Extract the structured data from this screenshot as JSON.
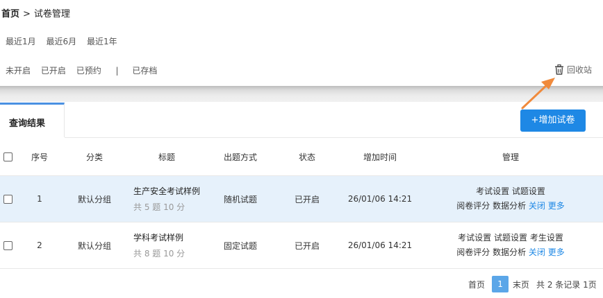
{
  "breadcrumb": {
    "home": "首页",
    "separator": ">",
    "current": "试卷管理"
  },
  "time_filters": [
    "最近1月",
    "最近6月",
    "最近1年"
  ],
  "status_filters": {
    "open_pending": "未开启",
    "opened": "已开启",
    "reserved": "已预约",
    "separator": "|",
    "archived": "已存档"
  },
  "recycle_bin": {
    "label": "回收站",
    "icon": "trash-icon"
  },
  "tab": {
    "label": "查询结果"
  },
  "add_button": {
    "label": "+增加试卷"
  },
  "table": {
    "headers": {
      "seq": "序号",
      "category": "分类",
      "title": "标题",
      "mode": "出题方式",
      "status": "状态",
      "time": "增加时间",
      "manage": "管理"
    },
    "rows": [
      {
        "seq": "1",
        "category": "默认分组",
        "title": "生产安全考试样例",
        "summary": "共 5 题 10 分",
        "mode": "随机试题",
        "status": "已开启",
        "time": "26/01/06 14:21",
        "actions_line1": [
          "考试设置",
          "试题设置"
        ],
        "actions_line2": [
          "阅卷评分",
          "数据分析"
        ],
        "link_close": "关闭",
        "link_more": "更多"
      },
      {
        "seq": "2",
        "category": "默认分组",
        "title": "学科考试样例",
        "summary": "共 8 题 10 分",
        "mode": "固定试题",
        "status": "已开启",
        "time": "26/01/06 14:21",
        "actions_line1": [
          "考试设置",
          "试题设置",
          "考生设置"
        ],
        "actions_line2": [
          "阅卷评分",
          "数据分析"
        ],
        "link_close": "关闭",
        "link_more": "更多"
      }
    ]
  },
  "pagination": {
    "first": "首页",
    "current": "1",
    "last": "末页",
    "summary": "共 2 条记录 1页"
  },
  "colors": {
    "accent": "#1e88e5",
    "highlight_row": "#e6f1fb",
    "annotation_arrow": "#f08a3c"
  }
}
